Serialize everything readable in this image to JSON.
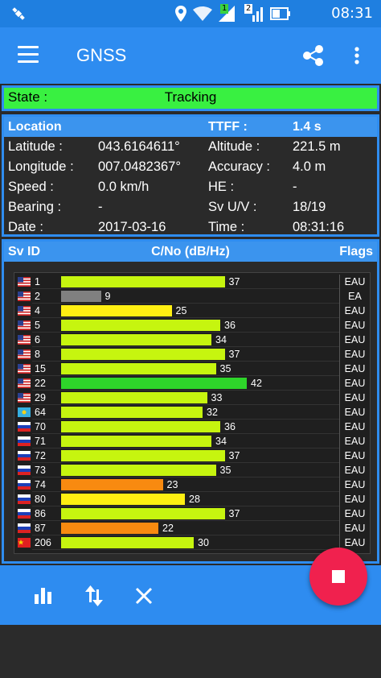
{
  "status_bar": {
    "time": "08:31",
    "sim1_badge": "1",
    "sim2_badge": "2",
    "icons": [
      "satellite-icon",
      "location-icon",
      "wifi-icon",
      "signal-sim1-icon",
      "signal-sim2-icon",
      "battery-icon"
    ]
  },
  "toolbar": {
    "title": "GNSS",
    "icons": [
      "menu-icon",
      "share-icon",
      "more-vert-icon"
    ]
  },
  "state": {
    "label": "State :",
    "value": "Tracking",
    "color": "#39f041"
  },
  "location": {
    "header_left": "Location",
    "header_ttff_label": "TTFF :",
    "header_ttff_value": "1.4 s",
    "rows": [
      {
        "l1": "Latitude :",
        "v1": "043.6164611°",
        "l2": "Altitude :",
        "v2": "221.5 m"
      },
      {
        "l1": "Longitude :",
        "v1": "007.0482367°",
        "l2": "Accuracy :",
        "v2": "4.0 m"
      },
      {
        "l1": "Speed :",
        "v1": "0.0 km/h",
        "l2": "HE :",
        "v2": "-"
      },
      {
        "l1": "Bearing :",
        "v1": "-",
        "l2": "Sv U/V :",
        "v2": "18/19"
      },
      {
        "l1": "Date :",
        "v1": "2017-03-16",
        "l2": "Time :",
        "v2": "08:31:16"
      }
    ]
  },
  "satellites": {
    "header_id": "Sv ID",
    "header_cno": "C/No (dB/Hz)",
    "header_flags": "Flags",
    "rows": [
      {
        "flag": "us",
        "id": "1",
        "cno": "37",
        "value": 37,
        "color": "#c6f50f",
        "flags": "EAU"
      },
      {
        "flag": "us",
        "id": "2",
        "cno": "9",
        "value": 9,
        "color": "#808080",
        "flags": "EA"
      },
      {
        "flag": "us",
        "id": "4",
        "cno": "25",
        "value": 25,
        "color": "#ffef12",
        "flags": "EAU"
      },
      {
        "flag": "us",
        "id": "5",
        "cno": "36",
        "value": 36,
        "color": "#c6f50f",
        "flags": "EAU"
      },
      {
        "flag": "us",
        "id": "6",
        "cno": "34",
        "value": 34,
        "color": "#c6f50f",
        "flags": "EAU"
      },
      {
        "flag": "us",
        "id": "8",
        "cno": "37",
        "value": 37,
        "color": "#c6f50f",
        "flags": "EAU"
      },
      {
        "flag": "us",
        "id": "15",
        "cno": "35",
        "value": 35,
        "color": "#c6f50f",
        "flags": "EAU"
      },
      {
        "flag": "us",
        "id": "22",
        "cno": "42",
        "value": 42,
        "color": "#2ed52a",
        "flags": "EAU"
      },
      {
        "flag": "us",
        "id": "29",
        "cno": "33",
        "value": 33,
        "color": "#c6f50f",
        "flags": "EAU"
      },
      {
        "flag": "kz",
        "id": "64",
        "cno": "32",
        "value": 32,
        "color": "#c6f50f",
        "flags": "EAU"
      },
      {
        "flag": "ru",
        "id": "70",
        "cno": "36",
        "value": 36,
        "color": "#c6f50f",
        "flags": "EAU"
      },
      {
        "flag": "ru",
        "id": "71",
        "cno": "34",
        "value": 34,
        "color": "#c6f50f",
        "flags": "EAU"
      },
      {
        "flag": "ru",
        "id": "72",
        "cno": "37",
        "value": 37,
        "color": "#c6f50f",
        "flags": "EAU"
      },
      {
        "flag": "ru",
        "id": "73",
        "cno": "35",
        "value": 35,
        "color": "#c6f50f",
        "flags": "EAU"
      },
      {
        "flag": "ru",
        "id": "74",
        "cno": "23",
        "value": 23,
        "color": "#f88a10",
        "flags": "EAU"
      },
      {
        "flag": "ru",
        "id": "80",
        "cno": "28",
        "value": 28,
        "color": "#ffef12",
        "flags": "EAU"
      },
      {
        "flag": "ru",
        "id": "86",
        "cno": "37",
        "value": 37,
        "color": "#c6f50f",
        "flags": "EAU"
      },
      {
        "flag": "ru",
        "id": "87",
        "cno": "22",
        "value": 22,
        "color": "#f88a10",
        "flags": "EAU"
      },
      {
        "flag": "cn",
        "id": "206",
        "cno": "30",
        "value": 30,
        "color": "#c6f50f",
        "flags": "EAU"
      }
    ]
  },
  "bottom_bar": {
    "icons": [
      "bar-chart-icon",
      "swap-vert-icon",
      "close-icon",
      "stop-icon"
    ],
    "fab_color": "#f0214e"
  }
}
